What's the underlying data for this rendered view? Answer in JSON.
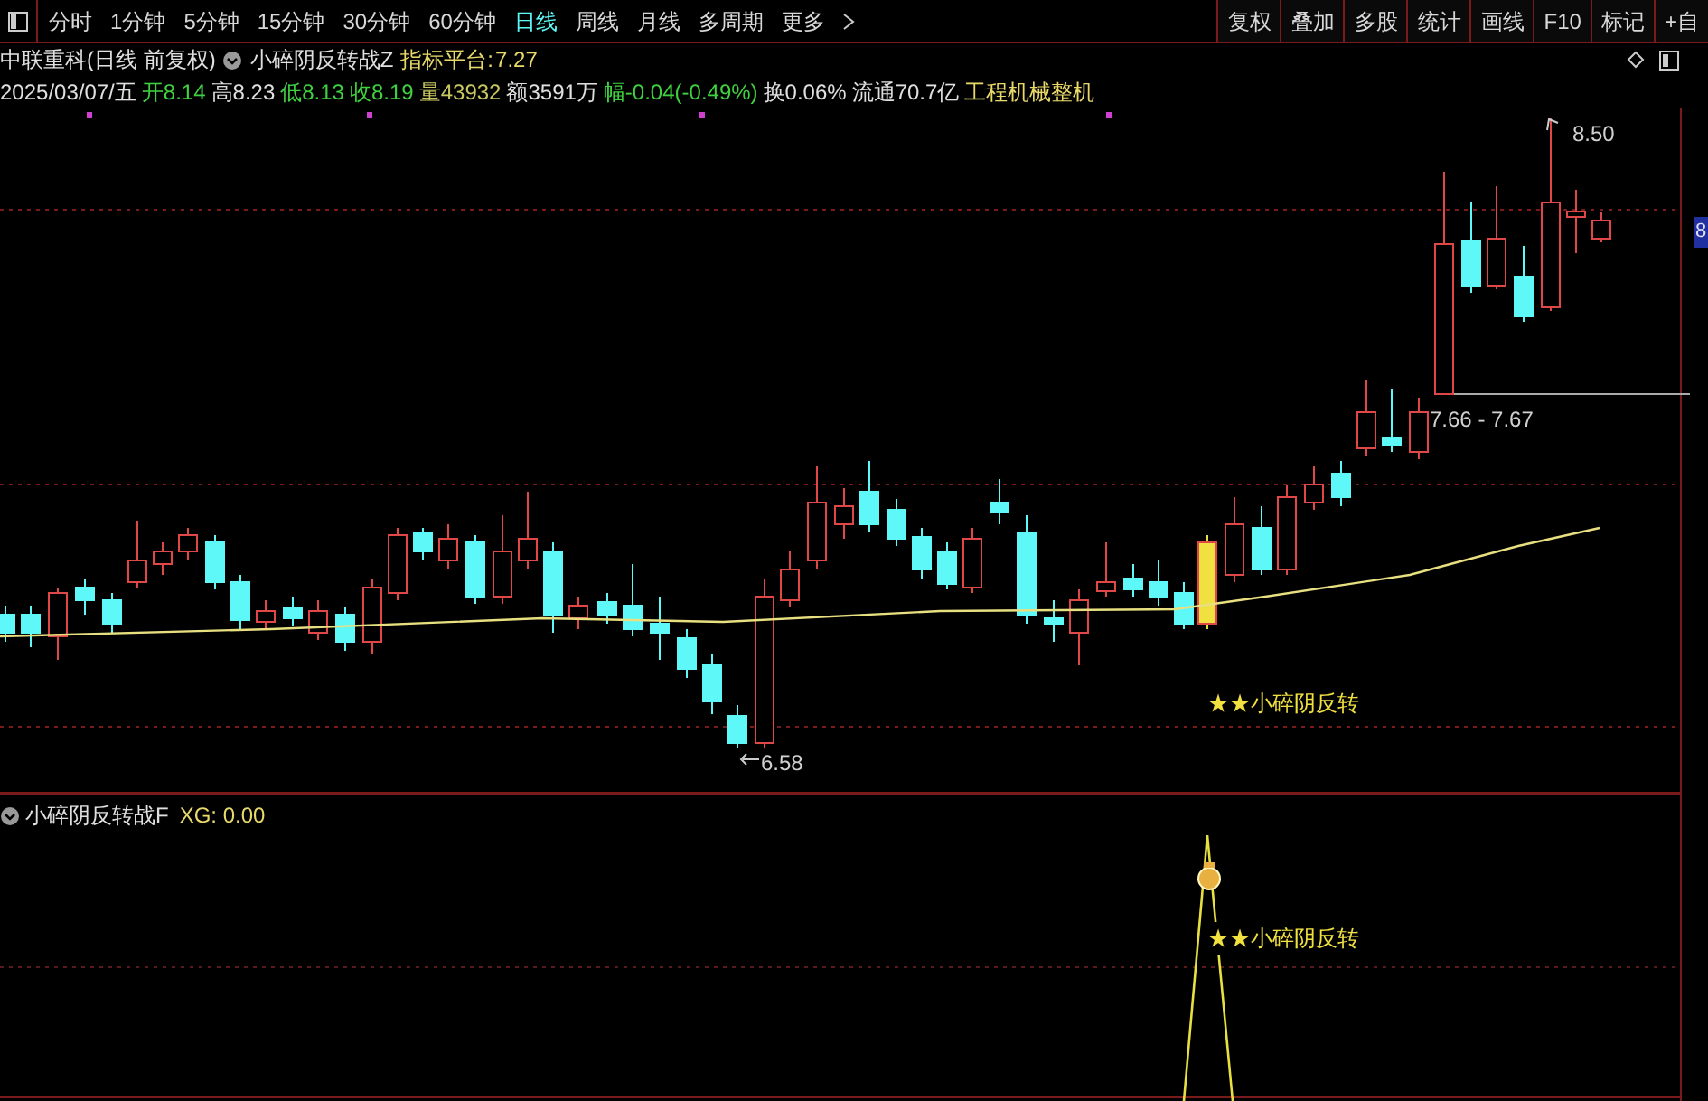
{
  "toolbar": {
    "periods": [
      {
        "label": "分时",
        "selected": false
      },
      {
        "label": "1分钟",
        "selected": false
      },
      {
        "label": "5分钟",
        "selected": false
      },
      {
        "label": "15分钟",
        "selected": false
      },
      {
        "label": "30分钟",
        "selected": false
      },
      {
        "label": "60分钟",
        "selected": false
      },
      {
        "label": "日线",
        "selected": true
      },
      {
        "label": "周线",
        "selected": false
      },
      {
        "label": "月线",
        "selected": false
      },
      {
        "label": "多周期",
        "selected": false
      },
      {
        "label": "更多",
        "selected": false
      }
    ],
    "tools": [
      "复权",
      "叠加",
      "多股",
      "统计",
      "画线",
      "F10",
      "标记",
      "+自"
    ]
  },
  "header": {
    "stock": "中联重科(日线 前复权)",
    "indicator": "小碎阴反转战Z",
    "indicator_label": "指标平台:",
    "indicator_value": "7.27"
  },
  "info_fields": [
    {
      "text": "2025/03/07/五",
      "color": "#e0e0e0"
    },
    {
      "text": "开8.14",
      "color": "#3fd13f"
    },
    {
      "text": "高8.23",
      "color": "#e0e0e0"
    },
    {
      "text": "低8.13",
      "color": "#3fd13f"
    },
    {
      "text": "收8.19",
      "color": "#3fd13f"
    },
    {
      "text": "量43932",
      "color": "#c8c860"
    },
    {
      "text": "额3591万",
      "color": "#e0e0e0"
    },
    {
      "text": "幅-0.04(-0.49%)",
      "color": "#3fd13f"
    },
    {
      "text": "换0.06%",
      "color": "#e0e0e0"
    },
    {
      "text": "流通70.7亿",
      "color": "#e0e0e0"
    },
    {
      "text": "工程机械整机",
      "color": "#e8d96a"
    }
  ],
  "main_chart": {
    "high_label": "8.50",
    "low_label": "6.58",
    "range_label": "7.66 - 7.67",
    "signal": "★★小碎阴反转",
    "price_tag": "8"
  },
  "sub_chart": {
    "title": "小碎阴反转战F",
    "value": "XG: 0.00",
    "signal": "★★小碎阴反转"
  }
}
